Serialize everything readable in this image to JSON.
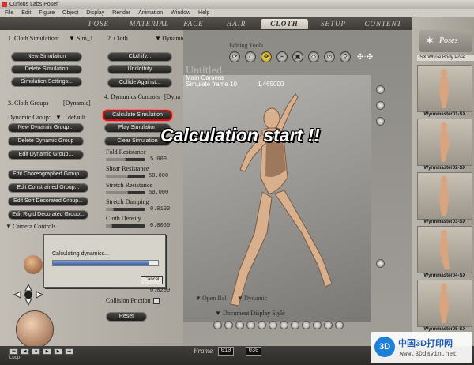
{
  "window": {
    "title": "Curious Labs Poser"
  },
  "menu": [
    "File",
    "Edit",
    "Figure",
    "Object",
    "Display",
    "Render",
    "Animation",
    "Window",
    "Help"
  ],
  "tabs": [
    "POSE",
    "MATERIAL",
    "FACE",
    "HAIR",
    "CLOTH",
    "SETUP",
    "CONTENT"
  ],
  "active_tab": "CLOTH",
  "left": {
    "cloth_sim_label": "1. Cloth Simulation:",
    "sim_name": "Sim_1",
    "cloth_label": "2. Cloth",
    "cloth_mode": "Dynamic",
    "sim_buttons": [
      "New Simulation",
      "Delete Simulation",
      "Simulation Settings..."
    ],
    "cloth_buttons": [
      "Clothify...",
      "Unclothify",
      "Collide Against..."
    ],
    "groups_label": "3. Cloth Groups",
    "groups_mode": "[Dynamic]",
    "dyn_group_label": "Dynamic Group:",
    "dyn_group_value": "default",
    "group_buttons": [
      "New Dynamic Group...",
      "Delete Dynamic Group",
      "Edit Dynamic Group..."
    ],
    "edit_buttons": [
      "Edit Choreographed Group...",
      "Edit Constrained Group...",
      "Edit Soft Decorated Group...",
      "Edit Rigid Decorated Group..."
    ],
    "dyn_controls_label": "4. Dynamics Controls",
    "dyn_controls_mode": "[Dyna",
    "sim_actions": [
      "Calculate Simulation",
      "Play Simulation",
      "Clear Simulation"
    ],
    "params": [
      {
        "label": "Fold Resistance",
        "value": "5.000",
        "fill": 0.5
      },
      {
        "label": "Shear Resistance",
        "value": "50.000",
        "fill": 0.55
      },
      {
        "label": "Stretch Resistance",
        "value": "50.000",
        "fill": 0.55
      },
      {
        "label": "Stretch Damping",
        "value": "0.0100",
        "fill": 0.2
      },
      {
        "label": "Cloth Density",
        "value": "0.0050",
        "fill": 0.15
      }
    ],
    "extra_value": "0.0200",
    "collision_friction_label": "Collision Friction",
    "reset_label": "Reset",
    "camera_controls_label": "Camera Controls"
  },
  "viewport": {
    "editing_tools_label": "Editing Tools",
    "doc_title": "Untitled",
    "camera_name": "Main Camera",
    "frame_status": "Simulate frame 10",
    "elapsed": "1.465000",
    "caption": "Calculation start !!",
    "open_ball_label": "Open Bal",
    "dynamic_label": "Dynamic",
    "doc_display_label": "Document Display Style"
  },
  "dialog": {
    "message": "Calculating dynamics...",
    "progress": 0.92,
    "cancel": "Cancel"
  },
  "right": {
    "poses_title": "Poses",
    "library": "ISX Whole Body Pose",
    "thumbs": [
      "Wyrmmaster01-SX",
      "Wyrmmaster02-SX",
      "Wyrmmaster03-SX",
      "Wyrmmaster04-SX",
      "Wyrmmaster05-SX"
    ]
  },
  "bottom": {
    "frame_label": "Frame",
    "frame_current": "010",
    "frame_total": "030",
    "loop": "Loop"
  },
  "watermark": {
    "logo": "3D",
    "text": "中国3D打印网",
    "url": "www.3Ddayin.net"
  }
}
